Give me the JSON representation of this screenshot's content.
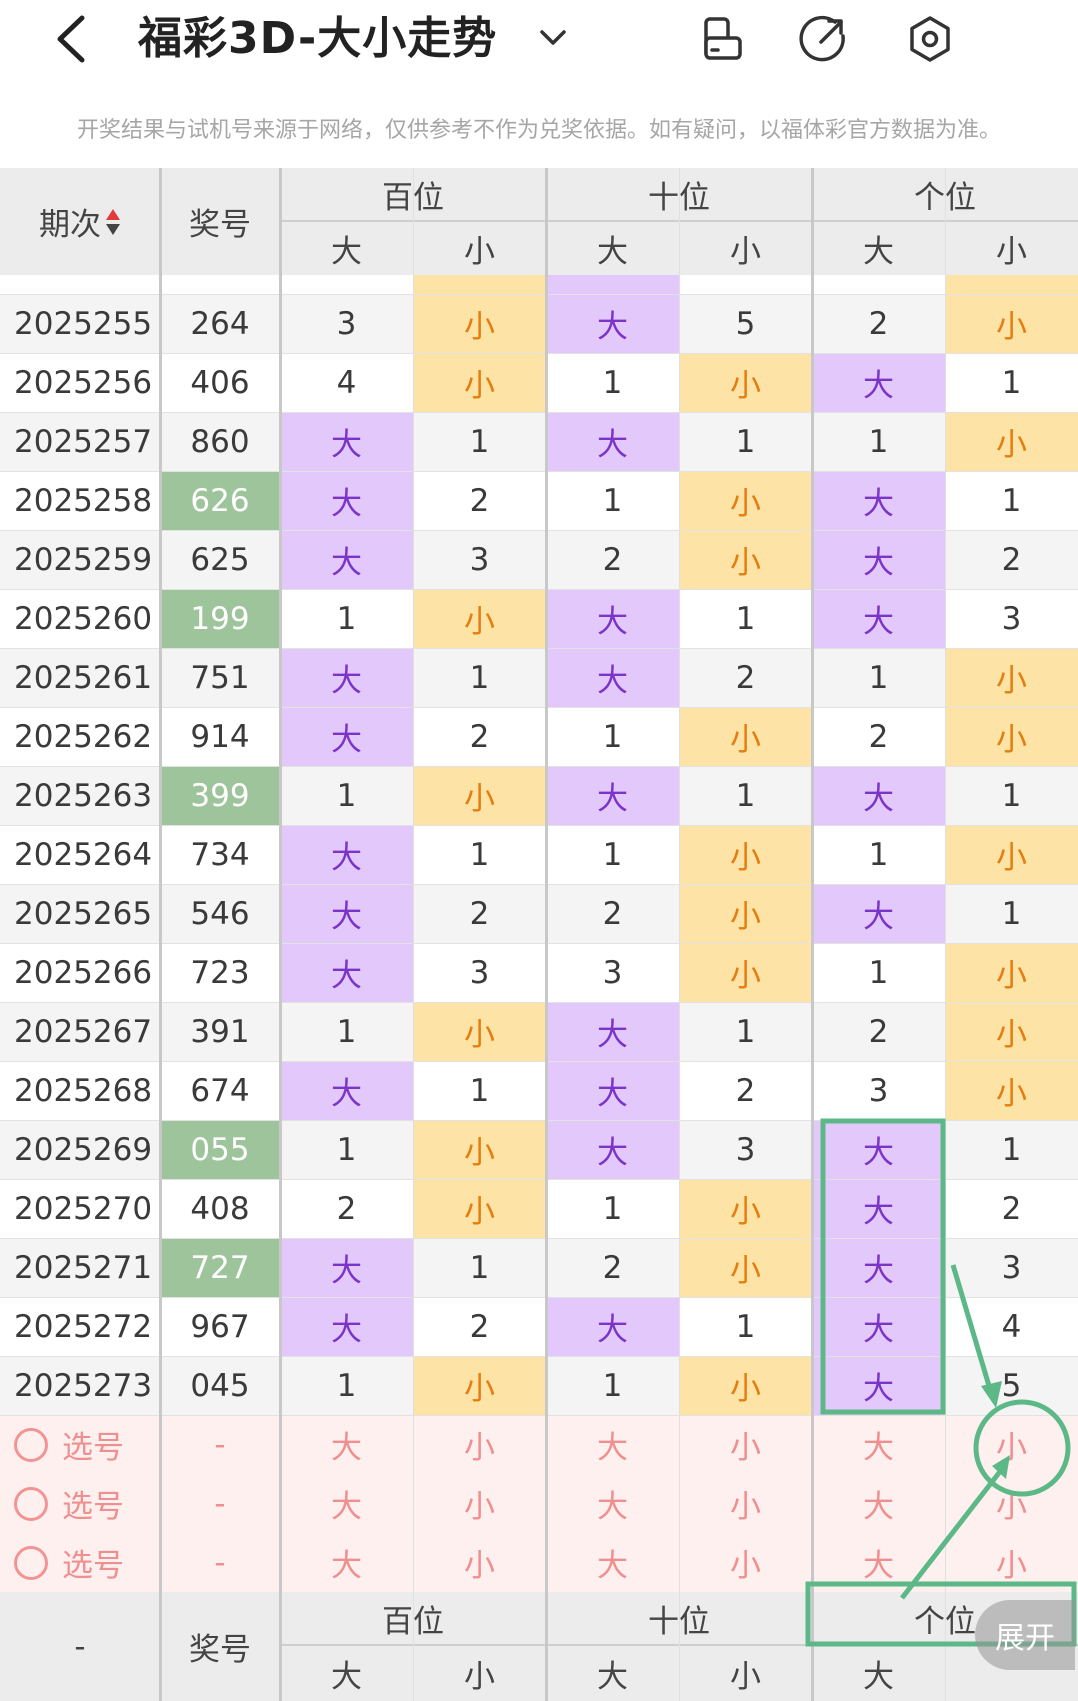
{
  "header": {
    "title": "福彩3D-大小走势",
    "notice": "开奖结果与试机号来源于网络，仅供参考不作为兑奖依据。如有疑问，以福体彩官方数据为准。"
  },
  "columns": {
    "issue": "期次",
    "number": "奖号",
    "groups": [
      "百位",
      "十位",
      "个位"
    ],
    "sub": [
      "大",
      "小"
    ]
  },
  "rows": [
    {
      "issue": "2025255",
      "number": "264",
      "hl": false,
      "cells": [
        [
          "3",
          "小"
        ],
        [
          "大",
          "5"
        ],
        [
          "2",
          "小"
        ]
      ]
    },
    {
      "issue": "2025256",
      "number": "406",
      "hl": false,
      "cells": [
        [
          "4",
          "小"
        ],
        [
          "1",
          "小"
        ],
        [
          "大",
          "1"
        ]
      ]
    },
    {
      "issue": "2025257",
      "number": "860",
      "hl": false,
      "cells": [
        [
          "大",
          "1"
        ],
        [
          "大",
          "1"
        ],
        [
          "1",
          "小"
        ]
      ]
    },
    {
      "issue": "2025258",
      "number": "626",
      "hl": true,
      "cells": [
        [
          "大",
          "2"
        ],
        [
          "1",
          "小"
        ],
        [
          "大",
          "1"
        ]
      ]
    },
    {
      "issue": "2025259",
      "number": "625",
      "hl": false,
      "cells": [
        [
          "大",
          "3"
        ],
        [
          "2",
          "小"
        ],
        [
          "大",
          "2"
        ]
      ]
    },
    {
      "issue": "2025260",
      "number": "199",
      "hl": true,
      "cells": [
        [
          "1",
          "小"
        ],
        [
          "大",
          "1"
        ],
        [
          "大",
          "3"
        ]
      ]
    },
    {
      "issue": "2025261",
      "number": "751",
      "hl": false,
      "cells": [
        [
          "大",
          "1"
        ],
        [
          "大",
          "2"
        ],
        [
          "1",
          "小"
        ]
      ]
    },
    {
      "issue": "2025262",
      "number": "914",
      "hl": false,
      "cells": [
        [
          "大",
          "2"
        ],
        [
          "1",
          "小"
        ],
        [
          "2",
          "小"
        ]
      ]
    },
    {
      "issue": "2025263",
      "number": "399",
      "hl": true,
      "cells": [
        [
          "1",
          "小"
        ],
        [
          "大",
          "1"
        ],
        [
          "大",
          "1"
        ]
      ]
    },
    {
      "issue": "2025264",
      "number": "734",
      "hl": false,
      "cells": [
        [
          "大",
          "1"
        ],
        [
          "1",
          "小"
        ],
        [
          "1",
          "小"
        ]
      ]
    },
    {
      "issue": "2025265",
      "number": "546",
      "hl": false,
      "cells": [
        [
          "大",
          "2"
        ],
        [
          "2",
          "小"
        ],
        [
          "大",
          "1"
        ]
      ]
    },
    {
      "issue": "2025266",
      "number": "723",
      "hl": false,
      "cells": [
        [
          "大",
          "3"
        ],
        [
          "3",
          "小"
        ],
        [
          "1",
          "小"
        ]
      ]
    },
    {
      "issue": "2025267",
      "number": "391",
      "hl": false,
      "cells": [
        [
          "1",
          "小"
        ],
        [
          "大",
          "1"
        ],
        [
          "2",
          "小"
        ]
      ]
    },
    {
      "issue": "2025268",
      "number": "674",
      "hl": false,
      "cells": [
        [
          "大",
          "1"
        ],
        [
          "大",
          "2"
        ],
        [
          "3",
          "小"
        ]
      ]
    },
    {
      "issue": "2025269",
      "number": "055",
      "hl": true,
      "cells": [
        [
          "1",
          "小"
        ],
        [
          "大",
          "3"
        ],
        [
          "大",
          "1"
        ]
      ]
    },
    {
      "issue": "2025270",
      "number": "408",
      "hl": false,
      "cells": [
        [
          "2",
          "小"
        ],
        [
          "1",
          "小"
        ],
        [
          "大",
          "2"
        ]
      ]
    },
    {
      "issue": "2025271",
      "number": "727",
      "hl": true,
      "cells": [
        [
          "大",
          "1"
        ],
        [
          "2",
          "小"
        ],
        [
          "大",
          "3"
        ]
      ]
    },
    {
      "issue": "2025272",
      "number": "967",
      "hl": false,
      "cells": [
        [
          "大",
          "2"
        ],
        [
          "大",
          "1"
        ],
        [
          "大",
          "4"
        ]
      ]
    },
    {
      "issue": "2025273",
      "number": "045",
      "hl": false,
      "cells": [
        [
          "1",
          "小"
        ],
        [
          "1",
          "小"
        ],
        [
          "大",
          "5"
        ]
      ]
    }
  ],
  "pick_rows": [
    {
      "label": "选号",
      "number": "-",
      "cells": [
        "大",
        "小",
        "大",
        "小",
        "大",
        "小"
      ]
    },
    {
      "label": "选号",
      "number": "-",
      "cells": [
        "大",
        "小",
        "大",
        "小",
        "大",
        "小"
      ]
    },
    {
      "label": "选号",
      "number": "-",
      "cells": [
        "大",
        "小",
        "大",
        "小",
        "大",
        "小"
      ]
    }
  ],
  "footer": {
    "issue": "-",
    "number": "奖号",
    "groups": [
      "百位",
      "十位",
      "个位"
    ],
    "sub": [
      "大",
      "小",
      "大",
      "小",
      "大"
    ],
    "expand": "展开"
  },
  "colors": {
    "big_bg": "#e3c8fb",
    "small_bg": "#fde3a6",
    "highlight_number": "#9dc49a",
    "annotation": "#5cb887",
    "pick_bg": "#fdf0ee"
  }
}
